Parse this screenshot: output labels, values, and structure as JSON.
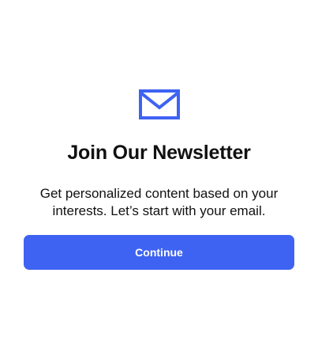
{
  "newsletter": {
    "icon": "envelope-icon",
    "title": "Join Our Newsletter",
    "subtitle": "Get personalized content based on your interests. Let’s start with your email.",
    "continue_label": "Continue",
    "colors": {
      "accent": "#3e63f2",
      "text": "#111111",
      "background": "#ffffff"
    }
  }
}
